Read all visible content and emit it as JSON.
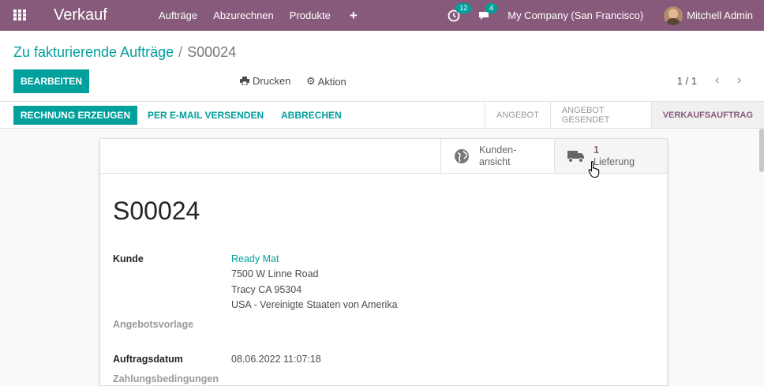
{
  "navbar": {
    "app_title": "Verkauf",
    "menu": [
      "Aufträge",
      "Abzurechnen",
      "Produkte"
    ],
    "activity_badge": "12",
    "messages_badge": "4",
    "company": "My Company (San Francisco)",
    "user": "Mitchell Admin"
  },
  "breadcrumb": {
    "parent": "Zu fakturierende Aufträge",
    "separator": "/",
    "current": "S00024"
  },
  "control": {
    "edit_label": "BEARBEITEN",
    "print_label": "Drucken",
    "action_label": "Aktion",
    "pager": "1 / 1"
  },
  "statusbar": {
    "create_invoice": "RECHNUNG ERZEUGEN",
    "send_email": "PER E-MAIL VERSENDEN",
    "cancel": "ABBRECHEN",
    "stages": [
      "ANGEBOT",
      "ANGEBOT GESENDET",
      "VERKAUFSAUFTRAG"
    ],
    "active_stage": "VERKAUFSAUFTRAG"
  },
  "smart_buttons": {
    "customer_preview_line1": "Kunden-",
    "customer_preview_line2": "ansicht",
    "delivery_count": "1",
    "delivery_label": "Lieferung"
  },
  "form": {
    "name": "S00024",
    "customer_label": "Kunde",
    "customer_name": "Ready Mat",
    "address_line1": "7500 W Linne Road",
    "address_line2": "Tracy CA 95304",
    "address_line3": "USA - Vereinigte Staaten von Amerika",
    "template_label": "Angebotsvorlage",
    "order_date_label": "Auftragsdatum",
    "order_date": "08.06.2022 11:07:18",
    "payment_terms_label": "Zahlungsbedingungen"
  },
  "colors": {
    "brand": "#875a7b",
    "accent": "#00a09d"
  }
}
